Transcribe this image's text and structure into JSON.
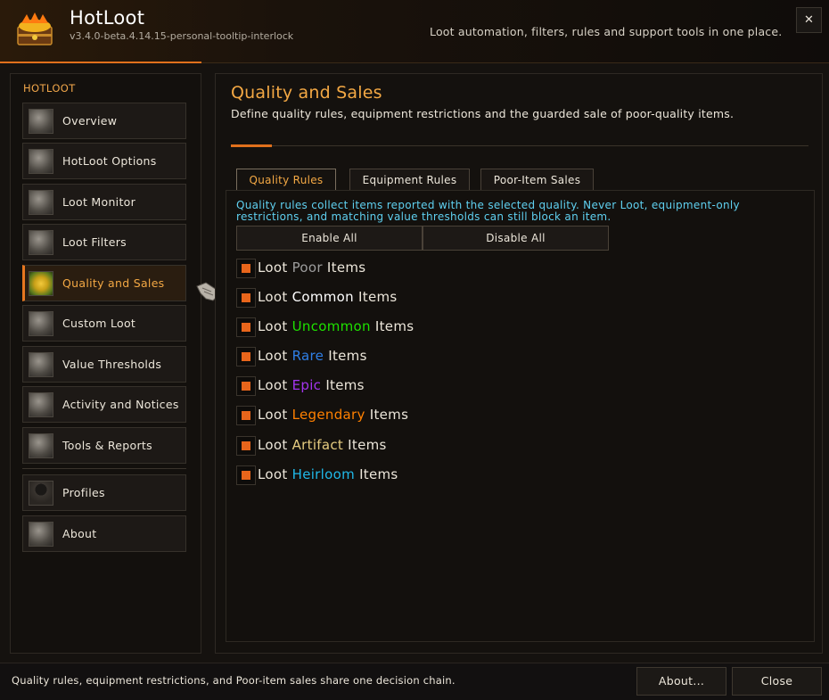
{
  "header": {
    "title": "HotLoot",
    "version": "v3.4.0-beta.4.14.15-personal-tooltip-interlock",
    "tagline": "Loot automation, filters, rules and support tools in one place.",
    "close_label": "✕"
  },
  "sidebar": {
    "heading": "HOTLOOT",
    "items": [
      {
        "label": "Overview",
        "icon": "scroll-icon"
      },
      {
        "label": "HotLoot Options",
        "icon": "gear-icon"
      },
      {
        "label": "Loot Monitor",
        "icon": "ring-icon"
      },
      {
        "label": "Loot Filters",
        "icon": "filter-icon"
      },
      {
        "label": "Quality and Sales",
        "icon": "gem-icon",
        "active": true
      },
      {
        "label": "Custom Loot",
        "icon": "scroll-icon"
      },
      {
        "label": "Value Thresholds",
        "icon": "coins-icon"
      },
      {
        "label": "Activity and Notices",
        "icon": "scroll-icon"
      },
      {
        "label": "Tools & Reports",
        "icon": "tools-icon"
      }
    ],
    "extra_items": [
      {
        "label": "Profiles",
        "icon": "profile-icon"
      },
      {
        "label": "About",
        "icon": "book-icon"
      }
    ]
  },
  "main": {
    "title": "Quality and Sales",
    "subtitle": "Define quality rules, equipment restrictions and the guarded sale of poor-quality items.",
    "tabs": [
      {
        "label": "Quality Rules",
        "active": true
      },
      {
        "label": "Equipment Rules"
      },
      {
        "label": "Poor-Item Sales"
      }
    ],
    "info": "Quality rules collect items reported with the selected quality. Never Loot, equipment-only restrictions, and matching value thresholds can still block an item.",
    "enable_all": "Enable All",
    "disable_all": "Disable All",
    "qualities": [
      {
        "prefix": "Loot",
        "quality": "Poor",
        "suffix": "Items",
        "color": "#9d9d9d",
        "checked": true
      },
      {
        "prefix": "Loot",
        "quality": "Common",
        "suffix": "Items",
        "color": "#ffffff",
        "checked": true
      },
      {
        "prefix": "Loot",
        "quality": "Uncommon",
        "suffix": "Items",
        "color": "#1eff00",
        "checked": true
      },
      {
        "prefix": "Loot",
        "quality": "Rare",
        "suffix": "Items",
        "color": "#0070dd",
        "checked": true
      },
      {
        "prefix": "Loot",
        "quality": "Epic",
        "suffix": "Items",
        "color": "#a335ee",
        "checked": true
      },
      {
        "prefix": "Loot",
        "quality": "Legendary",
        "suffix": "Items",
        "color": "#ff8000",
        "checked": true
      },
      {
        "prefix": "Loot",
        "quality": "Artifact",
        "suffix": "Items",
        "color": "#e6cc80",
        "checked": true
      },
      {
        "prefix": "Loot",
        "quality": "Heirloom",
        "suffix": "Items",
        "color": "#00ccff",
        "checked": true
      }
    ]
  },
  "footer": {
    "text": "Quality rules, equipment restrictions, and Poor-item sales share one decision chain.",
    "about_label": "About...",
    "close_label": "Close"
  }
}
